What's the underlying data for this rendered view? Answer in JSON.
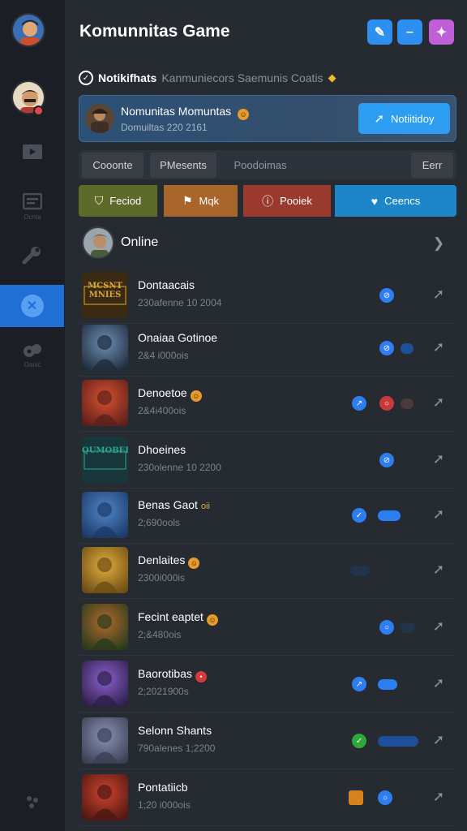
{
  "header": {
    "title": "Komunnitas Game",
    "buttons": [
      {
        "name": "edit",
        "glyph": "✎",
        "color": "#2d8ff0"
      },
      {
        "name": "minus",
        "glyph": "–",
        "color": "#2d8ff0"
      },
      {
        "name": "game",
        "glyph": "✦",
        "color": "#c15fd8"
      }
    ]
  },
  "notification": {
    "label": "Notikifhats",
    "text": "Kanmuniecors Saemunis Coatis"
  },
  "banner": {
    "title": "Nomunitas Momuntas",
    "subtitle": "Domuiltas 220 2161",
    "button": "Notiitidoy"
  },
  "filters": [
    {
      "label": "Cooonte",
      "active": true
    },
    {
      "label": "PMesents",
      "active": true
    },
    {
      "label": "Poodoimas",
      "active": false
    },
    {
      "label": "Eerr",
      "active": true
    }
  ],
  "categories": [
    {
      "label": "Feciod",
      "icon": "shield-icon",
      "color": "#6a7a2c"
    },
    {
      "label": "Mqk",
      "icon": "flag-icon",
      "color": "#a8652c"
    },
    {
      "label": "Pooiek",
      "icon": "alert-icon",
      "color": "#9a3a2e"
    },
    {
      "label": "Ceencs",
      "icon": "heart-icon",
      "color": "#1d86c8"
    }
  ],
  "online_label": "Online",
  "games": [
    {
      "name": "Dontaacais",
      "sub": "230afenne 10 2004",
      "badge": "",
      "thumb_label": "MCSNT MNIES"
    },
    {
      "name": "Onaiaa Gotinoe",
      "sub": "2&4 i000ois",
      "badge": "",
      "thumb_label": ""
    },
    {
      "name": "Denoetoe",
      "sub": "2&4i400ois",
      "badge": "emoji",
      "thumb_label": ""
    },
    {
      "name": "Dhoeines",
      "sub": "230olenne 10 2200",
      "badge": "",
      "thumb_label": "QUMOBEE"
    },
    {
      "name": "Benas Gaot",
      "sub": "2;690ools",
      "badge": "tag",
      "tag": "oii",
      "thumb_label": ""
    },
    {
      "name": "Denlaites",
      "sub": "2300i000is",
      "badge": "emoji",
      "thumb_label": ""
    },
    {
      "name": "Fecint eaptet",
      "sub": "2;&480ois",
      "badge": "emoji",
      "thumb_label": ""
    },
    {
      "name": "Baorotibas",
      "sub": "2;2021900s",
      "badge": "red",
      "thumb_label": ""
    },
    {
      "name": "Selonn Shants",
      "sub": "790alenes 1;2200",
      "badge": "",
      "thumb_label": ""
    },
    {
      "name": "Pontatiicb",
      "sub": "1;20 i000ois",
      "badge": "",
      "thumb_label": ""
    }
  ],
  "sidebar": {
    "items": [
      {
        "name": "profile"
      },
      {
        "name": "friends"
      },
      {
        "name": "media"
      },
      {
        "name": "chat",
        "caption": "Ocnta"
      },
      {
        "name": "tools"
      },
      {
        "name": "community"
      },
      {
        "name": "games",
        "caption": "Oanic"
      }
    ]
  }
}
